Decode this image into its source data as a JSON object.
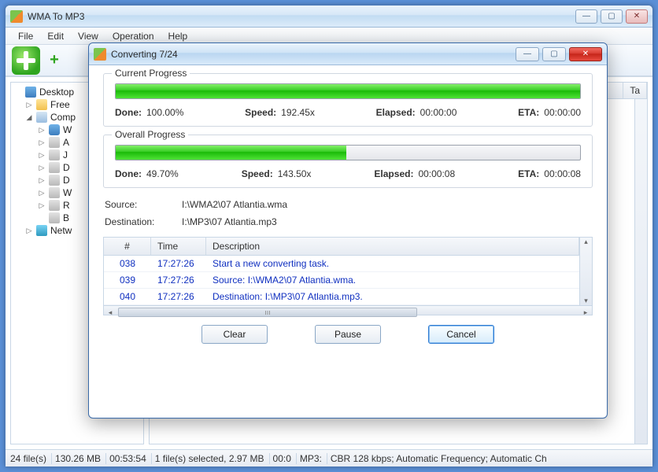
{
  "main": {
    "title": "WMA To MP3",
    "menu": [
      "File",
      "Edit",
      "View",
      "Operation",
      "Help"
    ],
    "right_col_header": "Ta",
    "tree": [
      {
        "label": "Desktop",
        "icon": "monitor",
        "indent": 0,
        "tri": ""
      },
      {
        "label": "Free",
        "icon": "folder",
        "indent": 1,
        "tri": "▷"
      },
      {
        "label": "Comp",
        "icon": "computer",
        "indent": 1,
        "tri": "◢"
      },
      {
        "label": "W",
        "icon": "win",
        "indent": 2,
        "tri": "▷"
      },
      {
        "label": "A",
        "icon": "drive",
        "indent": 2,
        "tri": "▷"
      },
      {
        "label": "J",
        "icon": "drive",
        "indent": 2,
        "tri": "▷"
      },
      {
        "label": "D",
        "icon": "drive",
        "indent": 2,
        "tri": "▷"
      },
      {
        "label": "D",
        "icon": "drive",
        "indent": 2,
        "tri": "▷"
      },
      {
        "label": "W",
        "icon": "drive",
        "indent": 2,
        "tri": "▷"
      },
      {
        "label": "R",
        "icon": "drive",
        "indent": 2,
        "tri": "▷"
      },
      {
        "label": "B",
        "icon": "drive",
        "indent": 2,
        "tri": ""
      },
      {
        "label": "Netw",
        "icon": "net",
        "indent": 1,
        "tri": "▷"
      }
    ],
    "status": {
      "files": "24 file(s)",
      "size": "130.26 MB",
      "dur": "00:53:54",
      "sel": "1 file(s) selected, 2.97 MB",
      "sel_dur": "00:0",
      "fmt": "MP3:",
      "enc": "CBR 128 kbps; Automatic Frequency; Automatic Ch"
    }
  },
  "modal": {
    "title": "Converting 7/24",
    "current": {
      "title": "Current Progress",
      "pct": 100,
      "labels": {
        "done": "Done:",
        "speed": "Speed:",
        "elapsed": "Elapsed:",
        "eta": "ETA:"
      },
      "values": {
        "done": "100.00%",
        "speed": "192.45x",
        "elapsed": "00:00:00",
        "eta": "00:00:00"
      }
    },
    "overall": {
      "title": "Overall Progress",
      "pct": 49.7,
      "labels": {
        "done": "Done:",
        "speed": "Speed:",
        "elapsed": "Elapsed:",
        "eta": "ETA:"
      },
      "values": {
        "done": "49.70%",
        "speed": "143.50x",
        "elapsed": "00:00:08",
        "eta": "00:00:08"
      }
    },
    "source": {
      "k": "Source:",
      "v": "I:\\WMA2\\07 Atlantia.wma"
    },
    "dest": {
      "k": "Destination:",
      "v": "I:\\MP3\\07 Atlantia.mp3"
    },
    "log": {
      "columns": {
        "num": "#",
        "time": "Time",
        "desc": "Description"
      },
      "rows": [
        {
          "num": "038",
          "time": "17:27:26",
          "desc": "Start a new converting task."
        },
        {
          "num": "039",
          "time": "17:27:26",
          "desc": "Source:  I:\\WMA2\\07 Atlantia.wma."
        },
        {
          "num": "040",
          "time": "17:27:26",
          "desc": "Destination: I:\\MP3\\07 Atlantia.mp3."
        }
      ],
      "midmark": "ııı"
    },
    "buttons": {
      "clear": "Clear",
      "pause": "Pause",
      "cancel": "Cancel"
    }
  }
}
